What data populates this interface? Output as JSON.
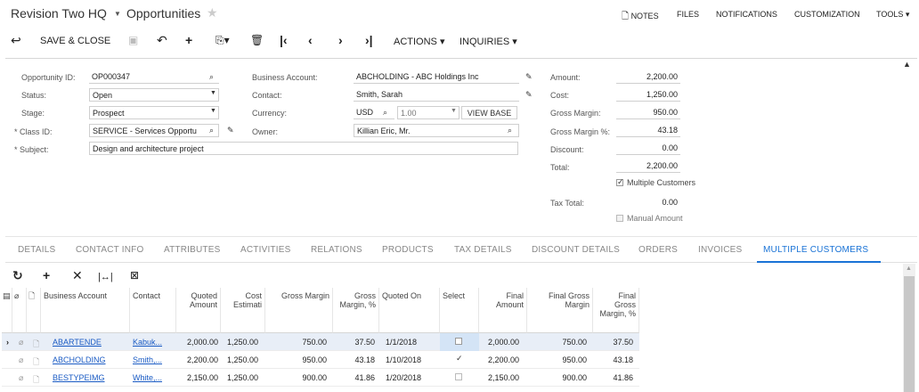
{
  "header": {
    "company": "Revision Two HQ",
    "screen_title": "Opportunities",
    "links": [
      "NOTES",
      "FILES",
      "NOTIFICATIONS",
      "CUSTOMIZATION",
      "TOOLS"
    ]
  },
  "toolbar": {
    "save_close": "SAVE & CLOSE",
    "actions": "ACTIONS",
    "inquiries": "INQUIRIES"
  },
  "summary": {
    "opportunity_id_label": "Opportunity ID:",
    "opportunity_id": "OP000347",
    "status_label": "Status:",
    "status": "Open",
    "stage_label": "Stage:",
    "stage": "Prospect",
    "class_id_label": "* Class ID:",
    "class_id": "SERVICE - Services Opportu",
    "subject_label": "* Subject:",
    "subject": "Design and architecture project",
    "business_account_label": "Business Account:",
    "business_account": "ABCHOLDING - ABC Holdings Inc",
    "contact_label": "Contact:",
    "contact": "Smith, Sarah",
    "currency_label": "Currency:",
    "currency": "USD",
    "currency_rate": "1.00",
    "view_base": "VIEW BASE",
    "owner_label": "Owner:",
    "owner": "Killian Eric, Mr.",
    "amount_label": "Amount:",
    "amount": "2,200.00",
    "cost_label": "Cost:",
    "cost": "1,250.00",
    "gross_margin_label": "Gross Margin:",
    "gross_margin": "950.00",
    "gross_margin_pct_label": "Gross Margin %:",
    "gross_margin_pct": "43.18",
    "discount_label": "Discount:",
    "discount": "0.00",
    "total_label": "Total:",
    "total": "2,200.00",
    "multiple_customers_label": "Multiple Customers",
    "multiple_customers": true,
    "tax_total_label": "Tax Total:",
    "tax_total": "0.00",
    "manual_amount_label": "Manual Amount",
    "manual_amount": false
  },
  "tabs": [
    "DETAILS",
    "CONTACT INFO",
    "ATTRIBUTES",
    "ACTIVITIES",
    "RELATIONS",
    "PRODUCTS",
    "TAX DETAILS",
    "DISCOUNT DETAILS",
    "ORDERS",
    "INVOICES",
    "MULTIPLE CUSTOMERS"
  ],
  "active_tab": "MULTIPLE CUSTOMERS",
  "grid": {
    "columns": {
      "business_account": "Business Account",
      "contact": "Contact",
      "quoted_amount": "Quoted Amount",
      "cost_estimate": "Cost Estimati",
      "gross_margin": "Gross Margin",
      "gross_margin_pct": "Gross Margin, %",
      "quoted_on": "Quoted On",
      "select": "Select",
      "final_amount": "Final Amount",
      "final_gross_margin": "Final Gross Margin",
      "final_gross_margin_pct": "Final Gross Margin, %"
    },
    "rows": [
      {
        "business_account": "ABARTENDE",
        "contact": "Kabuk...",
        "quoted_amount": "2,000.00",
        "cost_estimate": "1,250.00",
        "gross_margin": "750.00",
        "gross_margin_pct": "37.50",
        "quoted_on": "1/1/2018",
        "select": false,
        "final_amount": "2,000.00",
        "final_gross_margin": "750.00",
        "final_gross_margin_pct": "37.50"
      },
      {
        "business_account": "ABCHOLDING",
        "contact": "Smith,...",
        "quoted_amount": "2,200.00",
        "cost_estimate": "1,250.00",
        "gross_margin": "950.00",
        "gross_margin_pct": "43.18",
        "quoted_on": "1/10/2018",
        "select": true,
        "final_amount": "2,200.00",
        "final_gross_margin": "950.00",
        "final_gross_margin_pct": "43.18"
      },
      {
        "business_account": "BESTYPEIMG",
        "contact": "White,...",
        "quoted_amount": "2,150.00",
        "cost_estimate": "1,250.00",
        "gross_margin": "900.00",
        "gross_margin_pct": "41.86",
        "quoted_on": "1/20/2018",
        "select": false,
        "final_amount": "2,150.00",
        "final_gross_margin": "900.00",
        "final_gross_margin_pct": "41.86"
      }
    ]
  }
}
